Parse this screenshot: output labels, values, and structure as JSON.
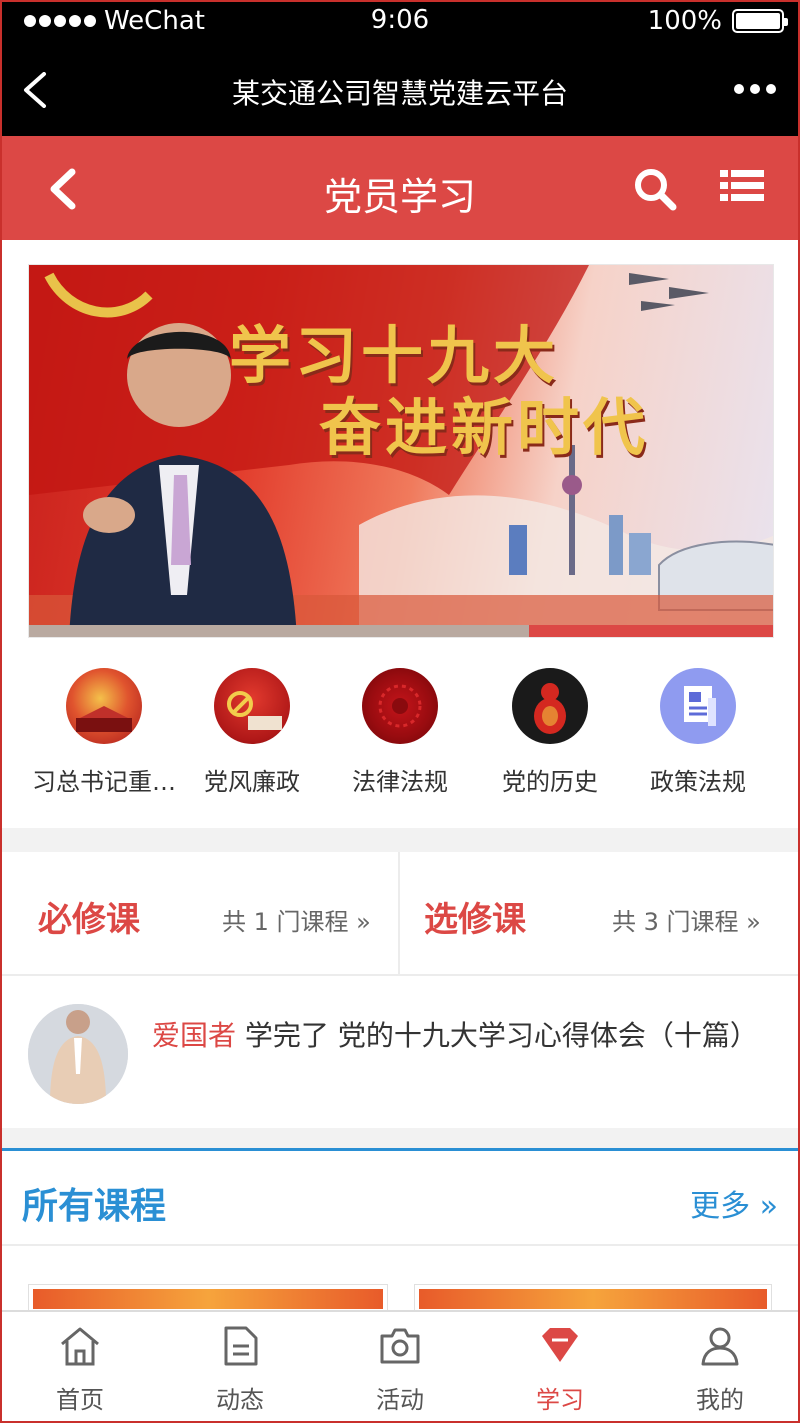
{
  "status_bar": {
    "carrier": "WeChat",
    "time": "9:06",
    "battery": "100%"
  },
  "wechat_nav": {
    "title": "某交通公司智慧党建云平台"
  },
  "header": {
    "title": "党员学习"
  },
  "banner": {
    "line1": "学习十九大",
    "line2": "奋进新时代",
    "slide_progress": 0.33
  },
  "categories": [
    {
      "label": "习总书记重…",
      "icon": "tiananmen-icon"
    },
    {
      "label": "党风廉政",
      "icon": "party-emblem-icon"
    },
    {
      "label": "法律法规",
      "icon": "red-pattern-icon"
    },
    {
      "label": "党的历史",
      "icon": "red-vase-icon"
    },
    {
      "label": "政策法规",
      "icon": "document-icon"
    }
  ],
  "courses": {
    "required": {
      "name": "必修课",
      "count": "共 1 门课程 »"
    },
    "elective": {
      "name": "选修课",
      "count": "共 3 门课程 »"
    }
  },
  "activity": {
    "user": "爱国者",
    "text": " 学完了 党的十九大学习心得体会（十篇）"
  },
  "all_courses": {
    "title": "所有课程",
    "more": "更多 »"
  },
  "tabbar": [
    {
      "label": "首页",
      "icon": "home-icon"
    },
    {
      "label": "动态",
      "icon": "document-icon"
    },
    {
      "label": "活动",
      "icon": "camera-icon"
    },
    {
      "label": "学习",
      "icon": "study-gem-icon",
      "active": true
    },
    {
      "label": "我的",
      "icon": "user-icon"
    }
  ],
  "colors": {
    "primary_red": "#dc4845",
    "accent_blue": "#2a8fd4"
  }
}
